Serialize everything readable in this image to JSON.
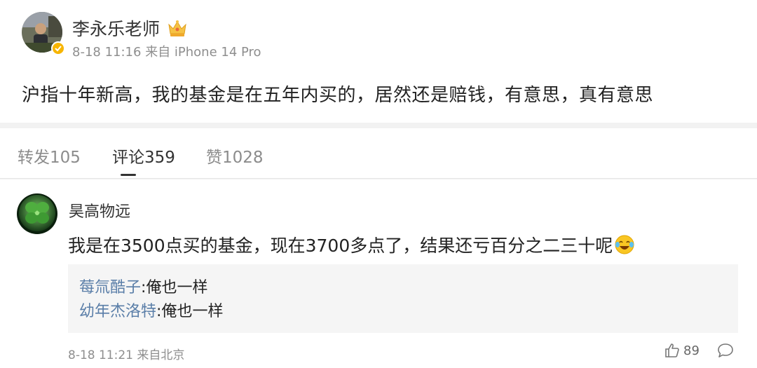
{
  "post": {
    "author": "李永乐老师",
    "timestamp": "8-18 11:16",
    "source": "来自 iPhone 14 Pro",
    "content": "沪指十年新高，我的基金是在五年内买的，居然还是赔钱，有意思，真有意思",
    "badge_icon": "crown-icon",
    "verified_color": "#f7b500"
  },
  "tabs": [
    {
      "label": "转发105",
      "active": false
    },
    {
      "label": "评论359",
      "active": true
    },
    {
      "label": "赞1028",
      "active": false
    }
  ],
  "comment": {
    "author": "昊高物远",
    "text": "我是在3500点买的基金，现在3700多点了，结果还亏百分之二三十呢",
    "emoji": "laugh-cry-emoji",
    "replies": [
      {
        "name": "莓氚酷子",
        "sep": ":",
        "text": "俺也一样"
      },
      {
        "name": "幼年杰洛特",
        "sep": ":",
        "text": "俺也一样"
      }
    ],
    "timestamp": "8-18 11:21",
    "source": "来自北京",
    "likes": "89"
  },
  "colors": {
    "link": "#5a7ea8",
    "meta": "#8e8e8e",
    "reply_bg": "#f5f5f5"
  }
}
